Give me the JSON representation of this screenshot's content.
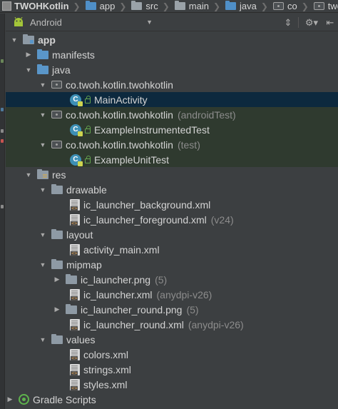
{
  "breadcrumb": [
    {
      "label": "TWOHKotlin",
      "icon": "module-icon"
    },
    {
      "label": "app",
      "icon": "module-folder-icon"
    },
    {
      "label": "src",
      "icon": "folder-icon"
    },
    {
      "label": "main",
      "icon": "folder-icon"
    },
    {
      "label": "java",
      "icon": "source-folder-icon"
    },
    {
      "label": "co",
      "icon": "package-icon"
    },
    {
      "label": "twoh",
      "icon": "package-icon"
    }
  ],
  "toolbar": {
    "view_mode": "Android",
    "collapse_icon": "collapse-all-icon",
    "settings_icon": "gear-icon",
    "hide_icon": "hide-panel-icon"
  },
  "tree": {
    "app": "app",
    "manifests": "manifests",
    "java": "java",
    "pkg_main": "co.twoh.kotlin.twohkotlin",
    "main_activity": "MainActivity",
    "pkg_android_test": "co.twoh.kotlin.twohkotlin",
    "pkg_android_test_hint": "(androidTest)",
    "instrumented_test": "ExampleInstrumentedTest",
    "pkg_test": "co.twoh.kotlin.twohkotlin",
    "pkg_test_hint": "(test)",
    "unit_test": "ExampleUnitTest",
    "res": "res",
    "drawable": "drawable",
    "ic_bg": "ic_launcher_background.xml",
    "ic_fg": "ic_launcher_foreground.xml",
    "ic_fg_hint": "(v24)",
    "layout": "layout",
    "activity_main": "activity_main.xml",
    "mipmap": "mipmap",
    "ic_png": "ic_launcher.png",
    "ic_png_hint": "(5)",
    "ic_xml": "ic_launcher.xml",
    "ic_xml_hint": "(anydpi-v26)",
    "ic_round_png": "ic_launcher_round.png",
    "ic_round_png_hint": "(5)",
    "ic_round_xml": "ic_launcher_round.xml",
    "ic_round_xml_hint": "(anydpi-v26)",
    "values": "values",
    "colors": "colors.xml",
    "strings": "strings.xml",
    "styles": "styles.xml",
    "gradle": "Gradle Scripts"
  },
  "colors": {
    "background": "#3c3f41",
    "selected_row": "#0d293e",
    "test_row": "#2f3a2f",
    "hint_text": "#8c8c8c"
  }
}
